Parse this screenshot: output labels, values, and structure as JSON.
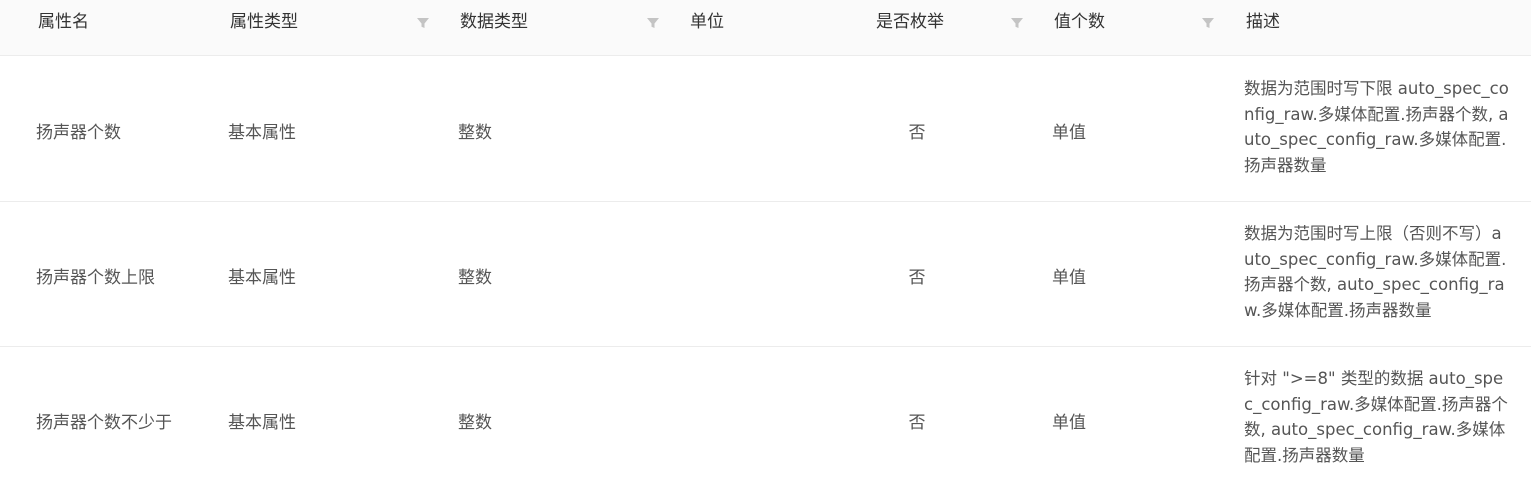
{
  "table": {
    "columns": [
      {
        "label": "属性名",
        "filter_icon": "filter-icon"
      },
      {
        "label": "属性类型",
        "filter_icon": "filter-icon"
      },
      {
        "label": "数据类型",
        "filter_icon": "filter-icon"
      },
      {
        "label": "单位",
        "filter_icon": null
      },
      {
        "label": "是否枚举",
        "filter_icon": "filter-icon"
      },
      {
        "label": "值个数",
        "filter_icon": "filter-icon"
      },
      {
        "label": "描述",
        "filter_icon": null
      }
    ],
    "rows": [
      {
        "name": "扬声器个数",
        "attr_type": "基本属性",
        "data_type": "整数",
        "unit": "",
        "is_enum": "否",
        "value_count": "单值",
        "description": "数据为范围时写下限 auto_spec_config_raw.多媒体配置.扬声器个数, auto_spec_config_raw.多媒体配置.扬声器数量"
      },
      {
        "name": "扬声器个数上限",
        "attr_type": "基本属性",
        "data_type": "整数",
        "unit": "",
        "is_enum": "否",
        "value_count": "单值",
        "description": "数据为范围时写上限（否则不写）auto_spec_config_raw.多媒体配置.扬声器个数, auto_spec_config_raw.多媒体配置.扬声器数量"
      },
      {
        "name": "扬声器个数不少于",
        "attr_type": "基本属性",
        "data_type": "整数",
        "unit": "",
        "is_enum": "否",
        "value_count": "单值",
        "description": "针对 \">=8\" 类型的数据 auto_spec_config_raw.多媒体配置.扬声器个数, auto_spec_config_raw.多媒体配置.扬声器数量"
      }
    ]
  },
  "colors": {
    "header_bg": "#fafafa",
    "border": "#ececec",
    "header_text": "#333333",
    "cell_text": "#555555",
    "filter_icon": "#c4c4c4"
  }
}
